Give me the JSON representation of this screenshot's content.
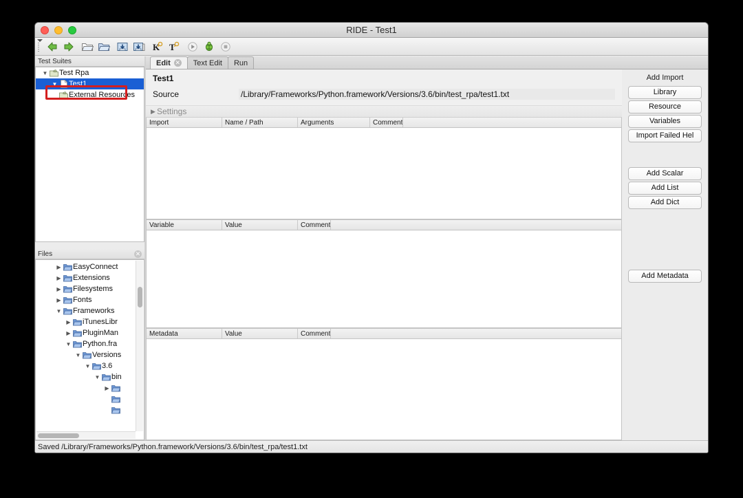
{
  "window": {
    "title": "RIDE - Test1"
  },
  "toolbar": {
    "items": [
      {
        "name": "back-arrow-icon",
        "label": "Back"
      },
      {
        "name": "forward-arrow-icon",
        "label": "Forward"
      },
      {
        "name": "open-folder-icon",
        "label": "Open"
      },
      {
        "name": "open-directory-icon",
        "label": "Open Directory"
      },
      {
        "name": "save-icon",
        "label": "Save"
      },
      {
        "name": "save-all-icon",
        "label": "Save All"
      },
      {
        "name": "search-keyword-icon",
        "label": "K"
      },
      {
        "name": "search-tests-icon",
        "label": "T"
      },
      {
        "name": "run-icon",
        "label": "Run"
      },
      {
        "name": "debug-icon",
        "label": "Debug"
      },
      {
        "name": "stop-icon",
        "label": "Stop"
      }
    ]
  },
  "suites_panel": {
    "header": "Test Suites",
    "items": [
      {
        "label": "Test Rpa",
        "icon": "suite-icon",
        "indent": 0,
        "twisty": "down",
        "selected": false
      },
      {
        "label": "Test1",
        "icon": "file-icon",
        "indent": 1,
        "twisty": "down",
        "selected": true
      },
      {
        "label": "External Resources",
        "icon": "suite-icon",
        "indent": 1,
        "twisty": "none",
        "selected": false
      }
    ]
  },
  "files_panel": {
    "header": "Files",
    "close_label": "✕",
    "items": [
      {
        "label": "EasyConnect",
        "indent": 2,
        "twisty": "right"
      },
      {
        "label": "Extensions",
        "indent": 2,
        "twisty": "right"
      },
      {
        "label": "Filesystems",
        "indent": 2,
        "twisty": "right"
      },
      {
        "label": "Fonts",
        "indent": 2,
        "twisty": "right"
      },
      {
        "label": "Frameworks",
        "indent": 2,
        "twisty": "down"
      },
      {
        "label": "iTunesLibr",
        "indent": 3,
        "twisty": "right"
      },
      {
        "label": "PluginMan",
        "indent": 3,
        "twisty": "right"
      },
      {
        "label": "Python.fra",
        "indent": 3,
        "twisty": "down"
      },
      {
        "label": "Versions",
        "indent": 4,
        "twisty": "down"
      },
      {
        "label": "3.6",
        "indent": 5,
        "twisty": "down"
      },
      {
        "label": "bin",
        "indent": 6,
        "twisty": "down"
      },
      {
        "label": "",
        "indent": 7,
        "twisty": "right"
      },
      {
        "label": "",
        "indent": 7,
        "twisty": "none"
      },
      {
        "label": "",
        "indent": 7,
        "twisty": "none"
      }
    ]
  },
  "tabs": [
    {
      "label": "Edit",
      "active": true,
      "closable": true,
      "close_glyph": "✕"
    },
    {
      "label": "Text Edit",
      "active": false,
      "closable": false
    },
    {
      "label": "Run",
      "active": false,
      "closable": false
    }
  ],
  "editor": {
    "doc_title": "Test1",
    "source_label": "Source",
    "source_value": "/Library/Frameworks/Python.framework/Versions/3.6/bin/test_rpa/test1.txt",
    "settings_label": "Settings",
    "settings_twisty": "▶",
    "import_grid": {
      "columns": [
        "Import",
        "Name / Path",
        "Arguments",
        "Comment"
      ],
      "rows": []
    },
    "variable_grid": {
      "columns": [
        "Variable",
        "Value",
        "Comment"
      ],
      "rows": []
    },
    "metadata_grid": {
      "columns": [
        "Metadata",
        "Value",
        "Comment"
      ],
      "rows": []
    }
  },
  "side_panel": {
    "add_import_label": "Add Import",
    "import_buttons": [
      "Library",
      "Resource",
      "Variables",
      "Import Failed Hel"
    ],
    "variable_buttons": [
      "Add Scalar",
      "Add List",
      "Add Dict"
    ],
    "metadata_buttons": [
      "Add Metadata"
    ]
  },
  "statusbar": {
    "text": "Saved /Library/Frameworks/Python.framework/Versions/3.6/bin/test_rpa/test1.txt"
  },
  "colors": {
    "selection": "#1a5fd4",
    "annotation": "#d41f1f",
    "window_bg": "#ececec"
  }
}
